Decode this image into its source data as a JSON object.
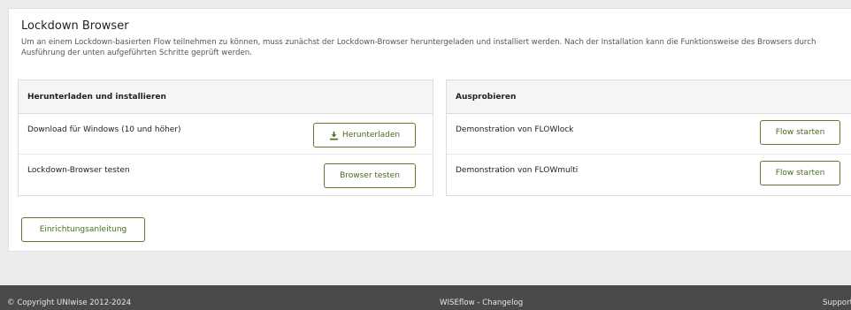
{
  "section": {
    "title": "Lockdown Browser",
    "description": "Um an einem Lockdown-basierten Flow teilnehmen zu können, muss zunächst der Lockdown-Browser heruntergeladen und installiert werden. Nach der Installation kann die Funktionsweise des Browsers durch Ausführung der unten aufgeführten Schritte geprüft werden."
  },
  "install_panel": {
    "heading": "Herunterladen und installieren",
    "rows": [
      {
        "label": "Download für Windows (10 und höher)",
        "button": "Herunterladen",
        "icon": "download-icon"
      },
      {
        "label": "Lockdown-Browser testen",
        "button": "Browser testen"
      }
    ]
  },
  "try_panel": {
    "heading": "Ausprobieren",
    "rows": [
      {
        "label": "Demonstration von FLOWlock",
        "button": "Flow starten"
      },
      {
        "label": "Demonstration von FLOWmulti",
        "button": "Flow starten"
      }
    ]
  },
  "setup_button": "Einrichtungsanleitung",
  "footer": {
    "copyright": "© Copyright UNIwise 2012-2024",
    "changelog": "WISEflow - Changelog",
    "support": "Support"
  },
  "colors": {
    "accent": "#4a6b1e",
    "accent_border": "#5b7a2a",
    "footer_bg": "#4a4a4a",
    "page_bg": "#ececec"
  }
}
